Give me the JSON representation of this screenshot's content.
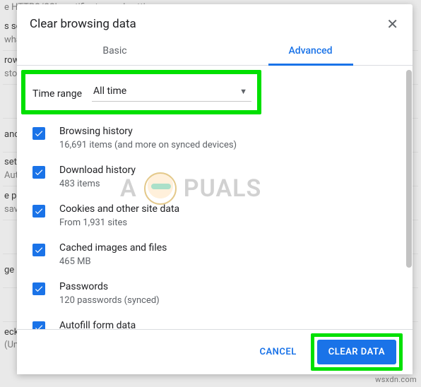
{
  "background": {
    "top": "e HTTPS/SSL certificates and settings",
    "rows": [
      {
        "l1": "s se",
        "l2": "wha"
      },
      {
        "l1": "row",
        "l2": "sto"
      },
      {
        "l1": "",
        "l2": ""
      },
      {
        "l1": "anc",
        "l2": ""
      },
      {
        "l1": "sett",
        "l2": "Aut"
      },
      {
        "l1": "e pa",
        "l2": "sav"
      },
      {
        "l1": "",
        "l2": ""
      },
      {
        "l1": "ge",
        "l2": ""
      },
      {
        "l1": "",
        "l2": ""
      },
      {
        "l1": "eck",
        "l2": "(United States)"
      }
    ]
  },
  "dialog": {
    "title": "Clear browsing data",
    "tabs": {
      "basic": "Basic",
      "advanced": "Advanced"
    },
    "time_range": {
      "label": "Time range",
      "value": "All time"
    },
    "items": [
      {
        "title": "Browsing history",
        "sub": "16,691 items (and more on synced devices)"
      },
      {
        "title": "Download history",
        "sub": "483 items"
      },
      {
        "title": "Cookies and other site data",
        "sub": "From 1,931 sites"
      },
      {
        "title": "Cached images and files",
        "sub": "465 MB"
      },
      {
        "title": "Passwords",
        "sub": "120 passwords (synced)"
      },
      {
        "title": "Autofill form data",
        "sub": ""
      }
    ],
    "buttons": {
      "cancel": "Cancel",
      "clear": "Clear data"
    }
  },
  "watermark": {
    "pre": "A",
    "post": "PUALS"
  },
  "brand": "wsxdn.com"
}
